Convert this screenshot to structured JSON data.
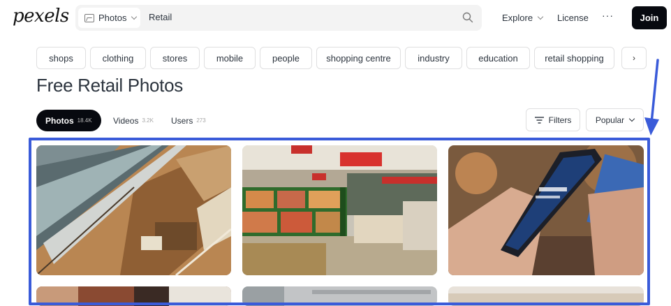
{
  "header": {
    "logo": "pexels",
    "search_type": "Photos",
    "search_query": "Retail",
    "nav_explore": "Explore",
    "nav_license": "License",
    "nav_more": "···",
    "join_label": "Join"
  },
  "chips": [
    "shops",
    "clothing",
    "stores",
    "mobile",
    "people",
    "shopping centre",
    "industry",
    "education",
    "retail shopping"
  ],
  "page_title": "Free Retail Photos",
  "tabs": [
    {
      "label": "Photos",
      "count": "18.4K"
    },
    {
      "label": "Videos",
      "count": "3.2K"
    },
    {
      "label": "Users",
      "count": "273"
    }
  ],
  "filters_label": "Filters",
  "sort_label": "Popular",
  "photos": [
    {
      "subject": "escalators-mall-aerial"
    },
    {
      "subject": "supermarket-produce-aisle"
    },
    {
      "subject": "hand-holding-smartphone-ecommerce"
    },
    {
      "subject": "retail-store-interior"
    },
    {
      "subject": "store-ceiling"
    },
    {
      "subject": "bright-store-interior"
    }
  ],
  "colors": {
    "accent": "#07090f",
    "annotation": "#3a5bd9"
  }
}
